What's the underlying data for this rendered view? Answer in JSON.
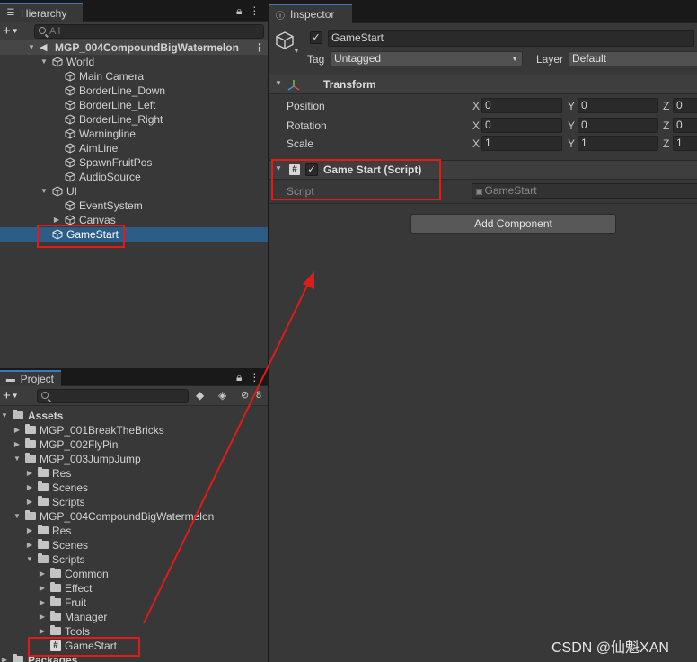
{
  "hierarchy": {
    "tab_label": "Hierarchy",
    "search_placeholder": "All",
    "scene_name": "MGP_004CompoundBigWatermelon",
    "items": [
      {
        "label": "World"
      },
      {
        "label": "Main Camera"
      },
      {
        "label": "BorderLine_Down"
      },
      {
        "label": "BorderLine_Left"
      },
      {
        "label": "BorderLine_Right"
      },
      {
        "label": "Warningline"
      },
      {
        "label": "AimLine"
      },
      {
        "label": "SpawnFruitPos"
      },
      {
        "label": "AudioSource"
      },
      {
        "label": "UI"
      },
      {
        "label": "EventSystem"
      },
      {
        "label": "Canvas"
      },
      {
        "label": "GameStart"
      }
    ]
  },
  "project": {
    "tab_label": "Project",
    "hidden_count": "8",
    "items": [
      {
        "label": "Assets"
      },
      {
        "label": "MGP_001BreakTheBricks"
      },
      {
        "label": "MGP_002FlyPin"
      },
      {
        "label": "MGP_003JumpJump"
      },
      {
        "label": "Res"
      },
      {
        "label": "Scenes"
      },
      {
        "label": "Scripts"
      },
      {
        "label": "MGP_004CompoundBigWatermelon"
      },
      {
        "label": "Res"
      },
      {
        "label": "Scenes"
      },
      {
        "label": "Scripts"
      },
      {
        "label": "Common"
      },
      {
        "label": "Effect"
      },
      {
        "label": "Fruit"
      },
      {
        "label": "Manager"
      },
      {
        "label": "Tools"
      },
      {
        "label": "GameStart"
      },
      {
        "label": "Packages"
      }
    ]
  },
  "inspector": {
    "tab_label": "Inspector",
    "object_name": "GameStart",
    "tag_label": "Tag",
    "tag_value": "Untagged",
    "layer_label": "Layer",
    "layer_value": "Default",
    "transform": {
      "title": "Transform",
      "position_label": "Position",
      "rotation_label": "Rotation",
      "scale_label": "Scale",
      "x": "X",
      "y": "Y",
      "z": "Z",
      "position": [
        "0",
        "0",
        "0"
      ],
      "rotation": [
        "0",
        "0",
        "0"
      ],
      "scale": [
        "1",
        "1",
        "1"
      ]
    },
    "script_component": {
      "title": "Game Start (Script)",
      "script_label": "Script",
      "script_value": "GameStart"
    },
    "add_component_label": "Add Component"
  },
  "watermark": "CSDN @仙魁XAN",
  "colors": {
    "selection": "#2c5d87",
    "highlight_box": "#e11a1a",
    "tab_accent": "#3a79bb"
  }
}
